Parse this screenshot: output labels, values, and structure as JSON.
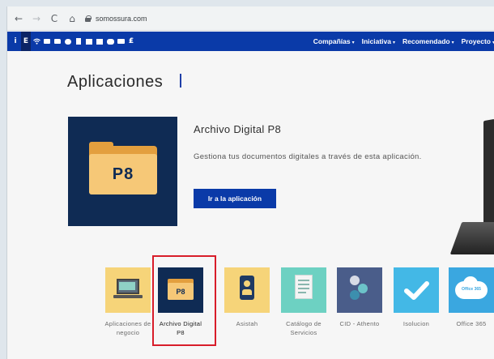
{
  "browser": {
    "back": "←",
    "forward": "→",
    "reload": "C",
    "home": "⌂",
    "url": "somossura.com"
  },
  "nav": {
    "icons": [
      "info-icon",
      "e-icon",
      "wifi-icon",
      "card-icon",
      "folder-icon",
      "chat-icon",
      "document-icon",
      "shop-icon",
      "building-icon",
      "gears-icon",
      "id-card-icon",
      "currency-icon"
    ],
    "info_glyph": "i",
    "e_glyph": "E",
    "currency_glyph": "₤",
    "links": [
      {
        "label": "Compañías"
      },
      {
        "label": "Iniciativa"
      },
      {
        "label": "Recomendado"
      },
      {
        "label": "Proyecto"
      }
    ],
    "caret": "▾"
  },
  "page": {
    "title": "Aplicaciones"
  },
  "featured": {
    "tile_text": "P8",
    "title": "Archivo Digital P8",
    "description": "Gestiona tus documentos digitales a través de esta aplicación.",
    "button": "Ir a la aplicación"
  },
  "apps": [
    {
      "label": "Aplicaciones de negocio",
      "icon": "laptop-chart-icon",
      "color": "#f6d479"
    },
    {
      "label": "Archivo Digital P8",
      "icon": "folder-p8-icon",
      "color": "#0f2b54",
      "tile_text": "P8",
      "selected": true
    },
    {
      "label": "Asistah",
      "icon": "id-badge-icon",
      "color": "#f6d479"
    },
    {
      "label": "Catálogo de Servicios",
      "icon": "document-list-icon",
      "color": "#6dd1c2"
    },
    {
      "label": "CID - Athento",
      "icon": "athento-dots-icon",
      "color": "#4a5d8a"
    },
    {
      "label": "Isolucion",
      "icon": "checkmark-icon",
      "color": "#43b8e6"
    },
    {
      "label": "Office 365",
      "icon": "office365-cloud-icon",
      "color": "#3aa7e0",
      "tile_text": "Office 365"
    }
  ],
  "colors": {
    "brand_blue": "#0a3aa8",
    "dark_navy": "#0f2b54",
    "highlight_red": "#d81d2a"
  }
}
